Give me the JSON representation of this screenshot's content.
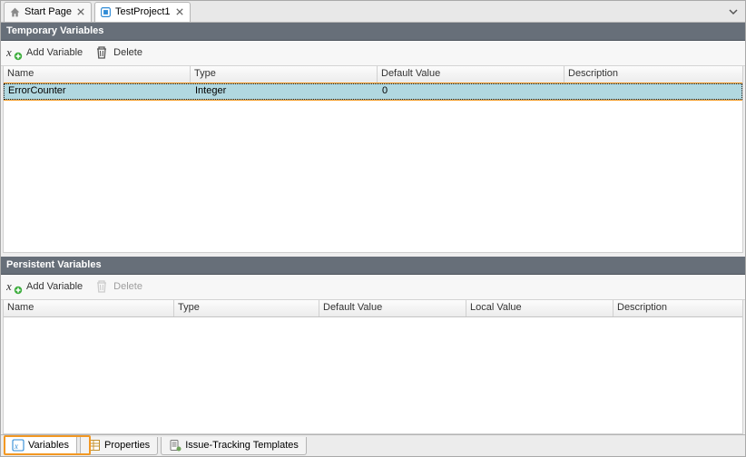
{
  "topTabs": {
    "start": "Start Page",
    "project": "TestProject1"
  },
  "temporary": {
    "title": "Temporary Variables",
    "addLabel": "Add Variable",
    "deleteLabel": "Delete",
    "columns": {
      "name": "Name",
      "type": "Type",
      "default": "Default Value",
      "desc": "Description"
    },
    "row": {
      "name": "ErrorCounter",
      "type": "Integer",
      "default": "0",
      "desc": ""
    }
  },
  "persistent": {
    "title": "Persistent Variables",
    "addLabel": "Add Variable",
    "deleteLabel": "Delete",
    "columns": {
      "name": "Name",
      "type": "Type",
      "default": "Default Value",
      "local": "Local Value",
      "desc": "Description"
    }
  },
  "bottomTabs": {
    "variables": "Variables",
    "properties": "Properties",
    "issue": "Issue-Tracking Templates"
  }
}
